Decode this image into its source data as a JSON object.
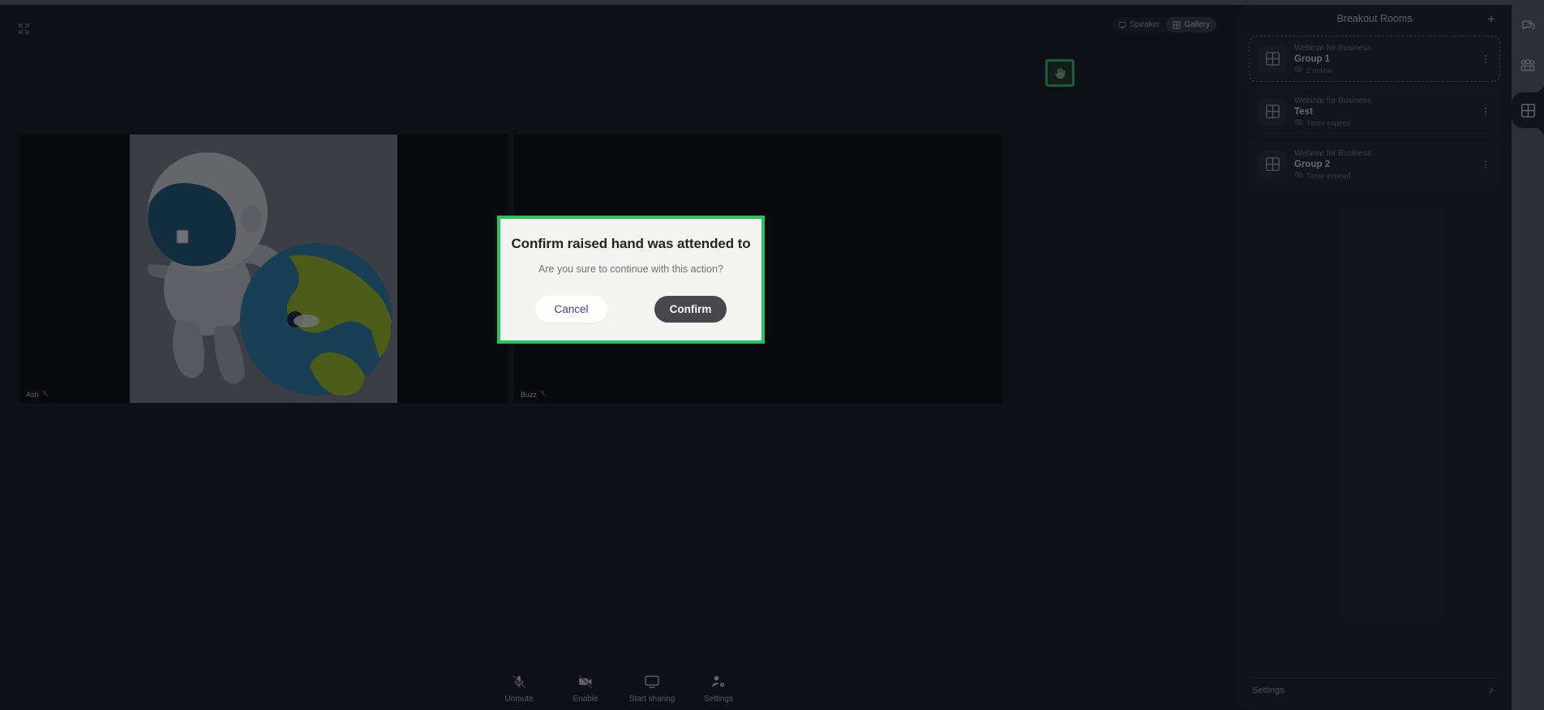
{
  "app": {
    "expand_icon": "expand-icon"
  },
  "stage": {
    "view_toggle": [
      {
        "label": "Speaker",
        "icon": "monitor-icon",
        "active": false
      },
      {
        "label": "Gallery",
        "icon": "grid-icon",
        "active": true
      }
    ],
    "tiles": [
      {
        "name": "Ash",
        "muted": true,
        "has_video": true
      },
      {
        "name": "Buzz",
        "muted": true,
        "has_video": false
      }
    ]
  },
  "toolbar": {
    "buttons": [
      {
        "label": "Unmute",
        "icon": "mic-off-icon"
      },
      {
        "label": "Enable",
        "icon": "camera-off-icon"
      },
      {
        "label": "Start sharing",
        "icon": "screen-share-icon"
      },
      {
        "label": "Settings",
        "icon": "user-settings-icon"
      }
    ]
  },
  "sidebar": {
    "title": "Breakout Rooms",
    "add_label": "+",
    "settings_label": "Settings",
    "rooms": [
      {
        "subtitle": "Webinar for Business",
        "name": "Group 1",
        "status": "2 online",
        "status_icon": "eye-icon",
        "selected": true,
        "raised_hand": true
      },
      {
        "subtitle": "Webinar for Business",
        "name": "Test",
        "status": "Timer expired",
        "status_icon": "eye-off-icon",
        "selected": false,
        "raised_hand": false
      },
      {
        "subtitle": "Webinar for Business",
        "name": "Group 2",
        "status": "Timer expired",
        "status_icon": "eye-off-icon",
        "selected": false,
        "raised_hand": false
      }
    ]
  },
  "rail": {
    "items": [
      {
        "name": "chat-icon",
        "active": false
      },
      {
        "name": "participants-icon",
        "active": false
      },
      {
        "name": "breakout-rooms-icon",
        "active": true
      }
    ]
  },
  "modal": {
    "title": "Confirm raised hand was attended to",
    "subtitle": "Are you sure to continue with this action?",
    "cancel_label": "Cancel",
    "confirm_label": "Confirm",
    "highlight_color": "#22c55e"
  }
}
